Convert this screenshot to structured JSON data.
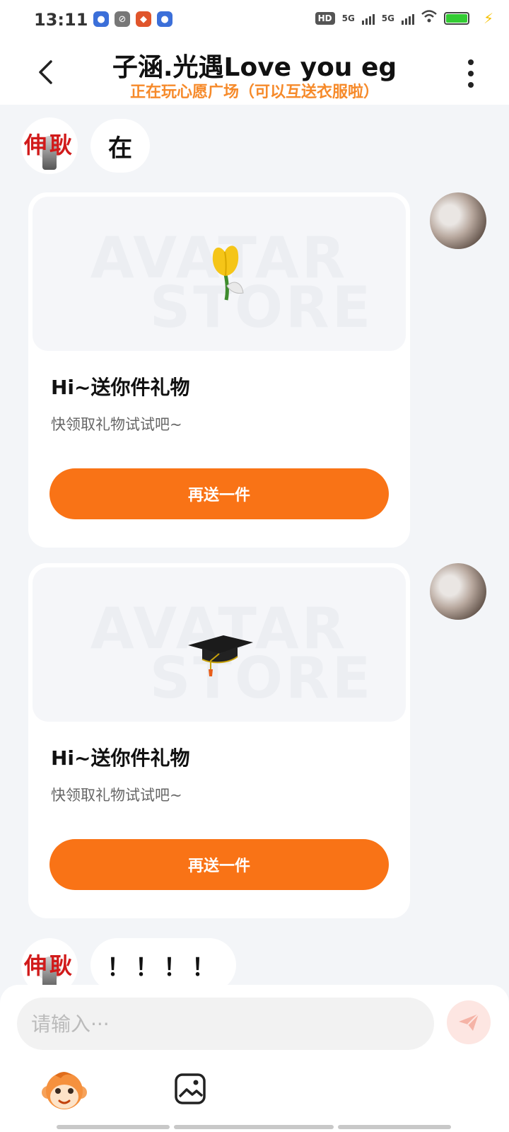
{
  "status_bar": {
    "time": "13:11",
    "network_1": "5G",
    "network_2": "5G",
    "hd_badge": "HD"
  },
  "header": {
    "title": "子涵.光遇Love you eg",
    "subtitle": "正在玩心愿广场（可以互送衣服啦）"
  },
  "messages": {
    "first_text": "在",
    "last_text": "！！！！"
  },
  "gift_cards": [
    {
      "item_icon": "tulip-icon",
      "watermark_line1": "AVATAR",
      "watermark_line2": "STORE",
      "title": "Hi~送你件礼物",
      "desc": "快领取礼物试试吧~",
      "button": "再送一件"
    },
    {
      "item_icon": "graduation-cap-icon",
      "watermark_line1": "AVATAR",
      "watermark_line2": "STORE",
      "title": "Hi~送你件礼物",
      "desc": "快领取礼物试试吧~",
      "button": "再送一件"
    }
  ],
  "input": {
    "placeholder": "请输入···"
  },
  "colors": {
    "accent": "#f97316",
    "subtitle": "#f68a2a",
    "background": "#f3f5f8"
  }
}
